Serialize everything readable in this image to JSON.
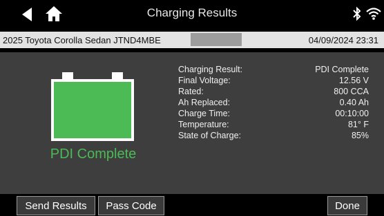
{
  "header": {
    "title": "Charging Results",
    "icons": [
      "back-arrow-icon",
      "home-icon",
      "bluetooth-icon",
      "wifi-icon"
    ]
  },
  "info_bar": {
    "vehicle": "2025 Toyota Corolla Sedan  JTND4MBE",
    "datetime": "04/09/2024 23:31"
  },
  "battery": {
    "status_label": "PDI Complete",
    "fill_color": "#4cba55"
  },
  "results": [
    {
      "label": "Charging Result:",
      "value": "PDI Complete"
    },
    {
      "label": "Final Voltage:",
      "value": "12.56 V"
    },
    {
      "label": "Rated:",
      "value": "800 CCA"
    },
    {
      "label": "Ah Replaced:",
      "value": "0.40 Ah"
    },
    {
      "label": "Charge Time:",
      "value": "00:10:00"
    },
    {
      "label": "Temperature:",
      "value": "81° F"
    },
    {
      "label": "State of Charge:",
      "value": "85%"
    }
  ],
  "buttons": {
    "send_results": "Send Results",
    "pass_code": "Pass Code",
    "done": "Done"
  }
}
